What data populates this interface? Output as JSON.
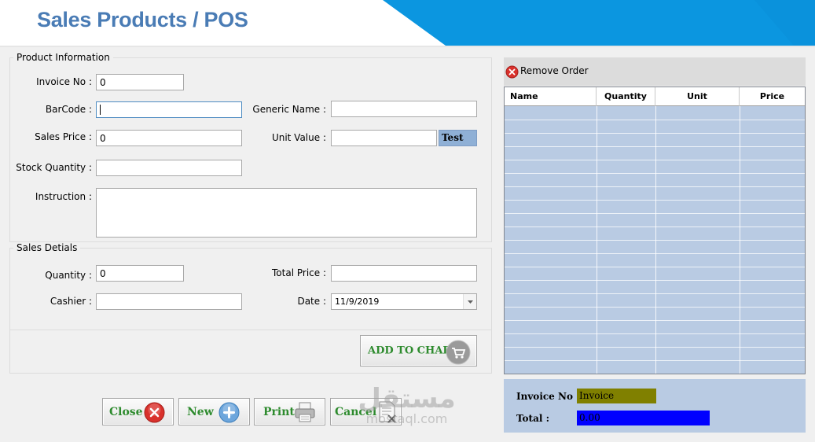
{
  "app": {
    "title": "Sales Products / POS"
  },
  "product_info": {
    "legend": "Product Information",
    "invoice_no": {
      "label": "Invoice No  :",
      "value": "0"
    },
    "barcode": {
      "label": "BarCode  :",
      "value": ""
    },
    "generic_name": {
      "label": "Generic Name  :",
      "value": ""
    },
    "sales_price": {
      "label": "Sales Price  :",
      "value": "0"
    },
    "unit_value": {
      "label": "Unit Value  :",
      "value": ""
    },
    "test_label": "Test",
    "stock_quantity": {
      "label": "Stock Quantity  :",
      "value": ""
    },
    "instruction": {
      "label": "Instruction  :",
      "value": ""
    }
  },
  "sales_details": {
    "legend": "Sales Detials",
    "quantity": {
      "label": "Quantity  :",
      "value": "0"
    },
    "total_price": {
      "label": "Total Price  :",
      "value": ""
    },
    "cashier": {
      "label": "Cashier  :",
      "value": ""
    },
    "date": {
      "label": "Date  :",
      "value": "11/9/2019"
    }
  },
  "add_to_chart_label": "ADD TO CHART",
  "buttons": {
    "close": "Close",
    "new": "New",
    "print": "Print",
    "cancel": "Cancel"
  },
  "order_panel": {
    "remove_order_label": "Remove Order",
    "columns": [
      "Name",
      "Quantity",
      "Unit",
      "Price"
    ]
  },
  "summary": {
    "invoice_label": "Invoice No :",
    "invoice_value": "Invoice",
    "total_label": "Total :",
    "total_value": "0.00"
  },
  "watermark": {
    "arabic": "مستقل",
    "latin": "mostaql.com"
  },
  "colors": {
    "title": "#4a7cb5",
    "banner": "#0b96e0",
    "grid_bg": "#b9cbe3",
    "button_text": "#2e8b2e",
    "invoice_box": "#808000",
    "total_box": "#0000ff",
    "test_box": "#8fb0d6"
  },
  "icons": {
    "remove_order": "red-x-circle-icon",
    "add_to_chart": "shopping-cart-icon",
    "close": "red-x-circle-icon",
    "new": "blue-plus-circle-icon",
    "print": "printer-icon",
    "cancel": "document-x-icon",
    "date_dropdown": "chevron-down-icon"
  }
}
